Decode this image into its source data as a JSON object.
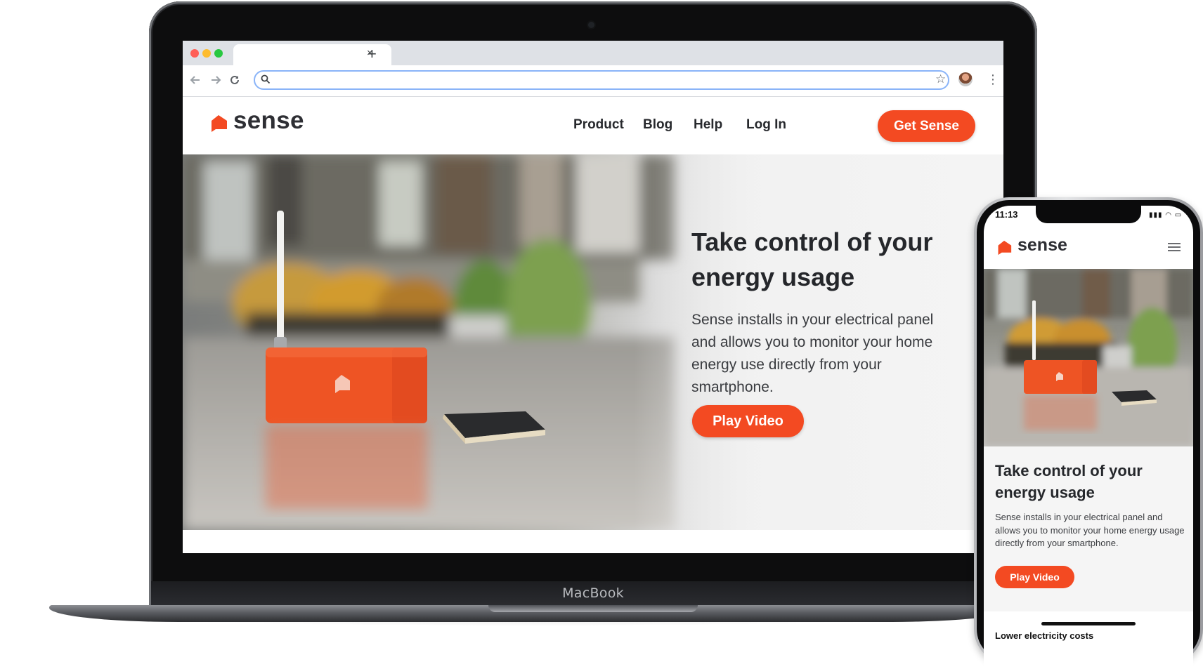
{
  "laptop": {
    "brand_label": "MacBook"
  },
  "browser": {
    "tab_close_glyph": "×",
    "new_tab_glyph": "+",
    "address_value": "",
    "icons": [
      "back-icon",
      "forward-icon",
      "reload-icon",
      "search-icon",
      "star-icon",
      "profile-avatar",
      "more-icon"
    ]
  },
  "site": {
    "logo": "sense",
    "nav": [
      "Product",
      "Blog",
      "Help",
      "Log In"
    ],
    "cta": "Get Sense",
    "hero": {
      "title": "Take control of your energy usage",
      "subtitle": "Sense installs in your electrical panel and allows you to monitor your home energy use directly from your smartphone.",
      "button": "Play Video"
    },
    "colors": {
      "accent": "#f34a22",
      "text_dark": "#25272b"
    }
  },
  "phone": {
    "time": "11:13",
    "status_icons": "▮▮▮ ◠ ▭",
    "logo": "sense",
    "hero": {
      "title": "Take control of your energy usage",
      "subtitle": "Sense installs in your electrical panel and allows you to monitor your home energy usage directly from your smartphone.",
      "button": "Play Video"
    },
    "next_section_peek": "Lower electricity costs"
  }
}
